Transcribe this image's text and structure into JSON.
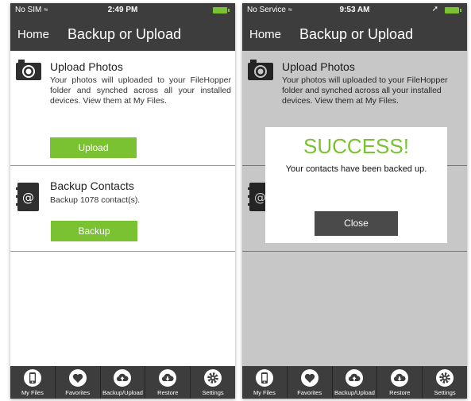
{
  "colors": {
    "accent": "#7ac231",
    "bar": "#3d3d3d"
  },
  "screen_left": {
    "status": {
      "carrier": "No SIM",
      "time": "2:49 PM"
    },
    "nav": {
      "home": "Home",
      "title": "Backup or Upload"
    },
    "upload": {
      "title": "Upload Photos",
      "description": "Your photos will uploaded to your FileHopper folder and synched across all your installed devices. View them at My Files.",
      "button": "Upload",
      "icon": "camera-icon"
    },
    "backup": {
      "title": "Backup Contacts",
      "description": "Backup 1078 contact(s).",
      "button": "Backup",
      "icon": "address-book-icon"
    },
    "tabs": [
      {
        "label": "My Files",
        "icon": "phone-icon"
      },
      {
        "label": "Favorites",
        "icon": "heart-icon"
      },
      {
        "label": "Backup/Upload",
        "icon": "cloud-upload-icon"
      },
      {
        "label": "Restore",
        "icon": "cloud-download-icon"
      },
      {
        "label": "Settings",
        "icon": "gear-icon"
      }
    ]
  },
  "screen_right": {
    "status": {
      "carrier": "No Service",
      "time": "9:53 AM"
    },
    "nav": {
      "home": "Home",
      "title": "Backup or Upload"
    },
    "upload": {
      "title": "Upload Photos",
      "description": "Your photos will uploaded to your FileHopper folder and synched across all your installed devices. View them at My Files."
    },
    "dialog": {
      "title": "SUCCESS!",
      "message": "Your contacts have been backed up.",
      "button": "Close"
    },
    "tabs": [
      {
        "label": "My Files",
        "icon": "phone-icon"
      },
      {
        "label": "Favorites",
        "icon": "heart-icon"
      },
      {
        "label": "Backup/Upload",
        "icon": "cloud-upload-icon"
      },
      {
        "label": "Restore",
        "icon": "cloud-download-icon"
      },
      {
        "label": "Settings",
        "icon": "gear-icon"
      }
    ]
  }
}
